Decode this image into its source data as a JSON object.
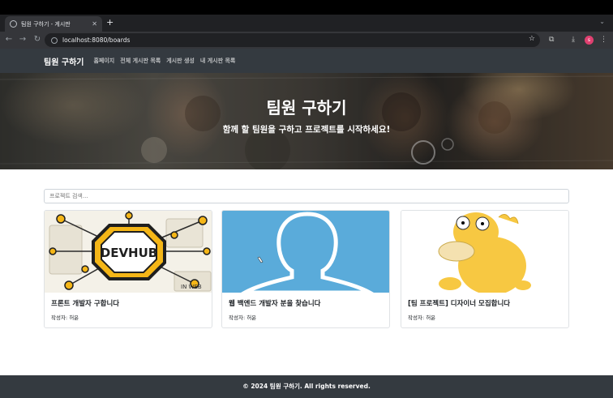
{
  "browser": {
    "tab_title": "팀원 구하기 - 게시판",
    "tab_close": "✕",
    "new_tab": "+",
    "url": "localhost:8080/boards",
    "profile_initial": "s"
  },
  "site": {
    "brand": "팀원 구하기",
    "nav": [
      "홈페이지",
      "전체 게시판 목록",
      "게시판 생성",
      "내 게시판 목록"
    ]
  },
  "hero": {
    "title": "팀원 구하기",
    "subtitle": "함께 할 팀원을 구하고 프로젝트를 시작하세요!"
  },
  "search": {
    "placeholder": "프로젝트 검색..."
  },
  "cards": [
    {
      "title": "프론트 개발자 구합니다",
      "author": "작성자: 허윤",
      "image": "devhub-illustration"
    },
    {
      "title": "웹 백엔드 개발자 분을 찾습니다",
      "author": "작성자: 허윤",
      "image": "default-profile-silhouette"
    },
    {
      "title": "[팀 프로젝트] 디자이너 모집합니다",
      "author": "작성자: 허윤",
      "image": "yellow-duck-character"
    }
  ],
  "footer": {
    "text": "© 2024 팀원 구하기. All rights reserved."
  },
  "colors": {
    "navbar": "#343a40",
    "footer": "#343a40",
    "silhouette_bg": "#5aabda"
  }
}
